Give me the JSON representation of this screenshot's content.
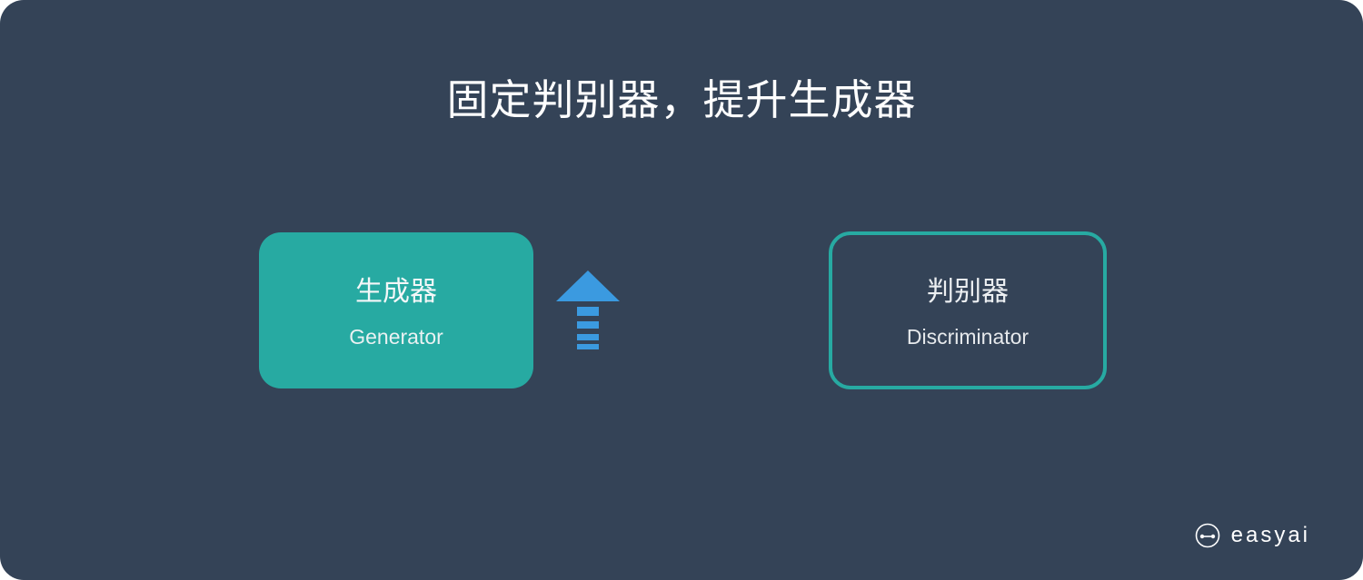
{
  "title": "固定判别器，提升生成器",
  "generator": {
    "label_cn": "生成器",
    "label_en": "Generator"
  },
  "discriminator": {
    "label_cn": "判别器",
    "label_en": "Discriminator"
  },
  "arrow": {
    "icon": "up-arrow-icon",
    "color": "#3b9ae0"
  },
  "brand": {
    "icon": "easyai-logo-icon",
    "text": "easyai"
  },
  "colors": {
    "background": "#344357",
    "accent_teal": "#27aaa2",
    "arrow_blue": "#3b9ae0",
    "text": "#ffffff"
  }
}
